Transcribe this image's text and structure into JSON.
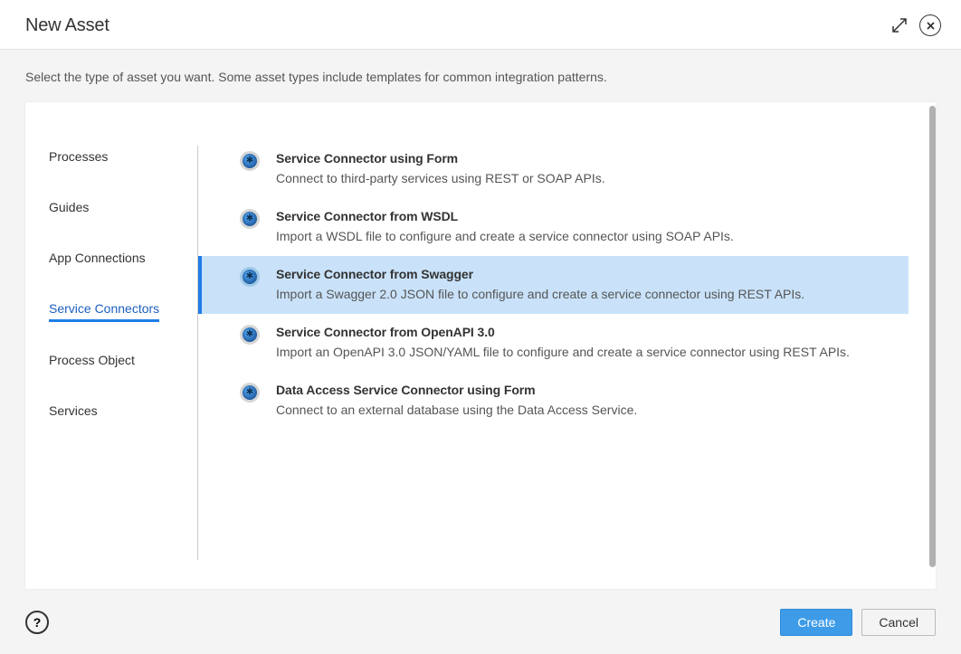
{
  "header": {
    "title": "New Asset"
  },
  "subtitle": "Select the type of asset you want. Some asset types include templates for common integration patterns.",
  "sidebar": {
    "items": [
      {
        "label": "Processes",
        "active": false
      },
      {
        "label": "Guides",
        "active": false
      },
      {
        "label": "App Connections",
        "active": false
      },
      {
        "label": "Service Connectors",
        "active": true
      },
      {
        "label": "Process Object",
        "active": false
      },
      {
        "label": "Services",
        "active": false
      }
    ]
  },
  "options": [
    {
      "title": "Service Connector using Form",
      "desc": "Connect to third-party services using REST or SOAP APIs.",
      "selected": false
    },
    {
      "title": "Service Connector from WSDL",
      "desc": "Import a WSDL file to configure and create a service connector using SOAP APIs.",
      "selected": false
    },
    {
      "title": "Service Connector from Swagger",
      "desc": "Import a Swagger 2.0 JSON file to configure and create a service connector using REST APIs.",
      "selected": true
    },
    {
      "title": "Service Connector from OpenAPI 3.0",
      "desc": "Import an OpenAPI 3.0 JSON/YAML file to configure and create a service connector using REST APIs.",
      "selected": false
    },
    {
      "title": "Data Access Service Connector using Form",
      "desc": "Connect to an external database using the Data Access Service.",
      "selected": false
    }
  ],
  "footer": {
    "help": "?",
    "create": "Create",
    "cancel": "Cancel"
  }
}
